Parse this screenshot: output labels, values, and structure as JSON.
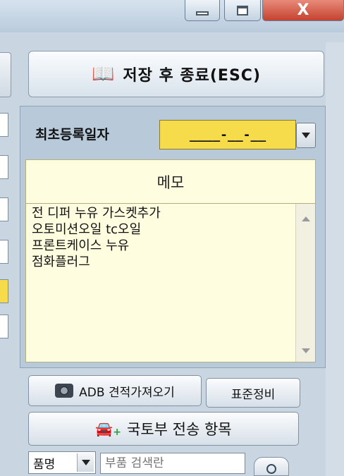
{
  "window": {
    "minimize_icon": "minimize-icon",
    "maximize_icon": "maximize-icon",
    "close_glyph": "X"
  },
  "toolbar": {
    "save_exit_label": "저장 후 종료(ESC)",
    "save_icon": "book-icon"
  },
  "registration": {
    "label": "최초등록일자",
    "date_value": "____-__-__"
  },
  "memo": {
    "header_label": "메모",
    "lines": [
      "전 디퍼 누유 가스켓추가",
      "오토미션오일 tc오일",
      "프론트케이스 누유",
      "점화플러그"
    ]
  },
  "buttons": {
    "adb_label": "ADB 견적가져오기",
    "standard_label": "표준정비",
    "molit_label": "국토부 전송 항목"
  },
  "parts": {
    "select_value": "품명",
    "search_placeholder": "부품 검색란"
  },
  "colors": {
    "date_highlight": "#f6dc4a",
    "memo_background": "#fffde0",
    "panel_background": "#b8c9da"
  }
}
